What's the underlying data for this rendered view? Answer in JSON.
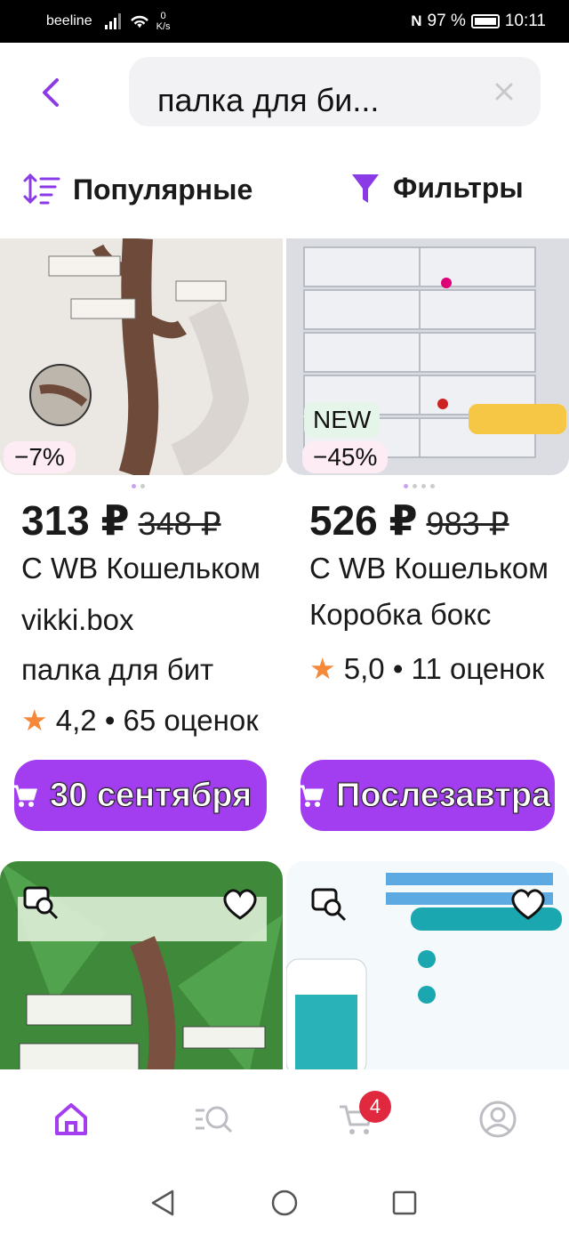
{
  "status": {
    "carrier": "beeline",
    "speed_top": "0",
    "speed_unit": "K/s",
    "battery": "97 %",
    "time": "10:11"
  },
  "search": {
    "query": "палка для би..."
  },
  "sort": {
    "label": "Популярные"
  },
  "filters": {
    "label": "Фильтры"
  },
  "products": [
    {
      "discount": "−7%",
      "price": "313 ₽",
      "old_price": "348 ₽",
      "wallet": "С WB Кошельком",
      "brand": "vikki.box",
      "name": "палка для бит",
      "rating": "4,2",
      "reviews": "• 65 оценок",
      "delivery": "30 сентября"
    },
    {
      "badge": "NEW",
      "discount": "−45%",
      "price": "526 ₽",
      "old_price": "983 ₽",
      "wallet": "С WB Кошельком",
      "name": "Коробка бокс",
      "rating": "5,0",
      "reviews": "• 11 оценок",
      "delivery": "Послезавтра"
    }
  ],
  "tabbar": {
    "cart_count": "4"
  },
  "colors": {
    "accent": "#a33ef0",
    "discount_bg": "#fdecf3",
    "new_bg": "#e6f5ea",
    "star": "#f6883a",
    "badge": "#e0283f"
  },
  "icons": [
    "back-icon",
    "clear-icon",
    "sort-icon",
    "filter-icon",
    "similar-icon",
    "heart-icon",
    "home-icon",
    "catalog-icon",
    "cart-icon",
    "profile-icon"
  ]
}
